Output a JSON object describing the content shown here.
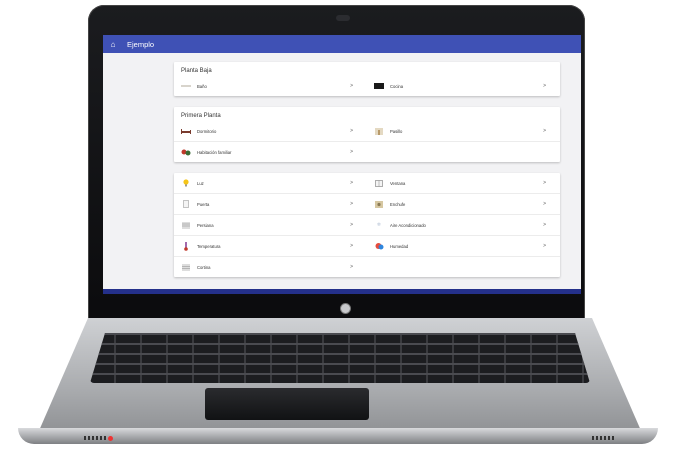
{
  "app": {
    "title": "Ejemplo"
  },
  "sections": [
    {
      "title": "Planta Baja",
      "items": [
        {
          "label": "Baño",
          "icon": "bathtub-icon"
        },
        {
          "label": "Cocina",
          "icon": "kitchen-icon"
        }
      ]
    },
    {
      "title": "Primera Planta",
      "items": [
        {
          "label": "Dormitorio",
          "icon": "bed-icon"
        },
        {
          "label": "Pasillo",
          "icon": "hallway-icon"
        },
        {
          "label": "Habitación familiar",
          "icon": "family-room-icon"
        }
      ]
    },
    {
      "title": "",
      "items": [
        {
          "label": "Luz",
          "icon": "lightbulb-icon"
        },
        {
          "label": "Ventana",
          "icon": "window-icon"
        },
        {
          "label": "Puerta",
          "icon": "door-icon"
        },
        {
          "label": "Enchufe",
          "icon": "plug-icon"
        },
        {
          "label": "Persiana",
          "icon": "blind-icon"
        },
        {
          "label": "Aire Acondicionado",
          "icon": "snowflake-icon"
        },
        {
          "label": "Temperatura",
          "icon": "thermometer-icon"
        },
        {
          "label": "Humedad",
          "icon": "humidity-icon"
        },
        {
          "label": "Cortina",
          "icon": "curtain-icon"
        }
      ]
    }
  ],
  "chevron": ">",
  "colors": {
    "appbar": "#3f51b5",
    "background": "#f2f2f4",
    "card": "#ffffff"
  }
}
